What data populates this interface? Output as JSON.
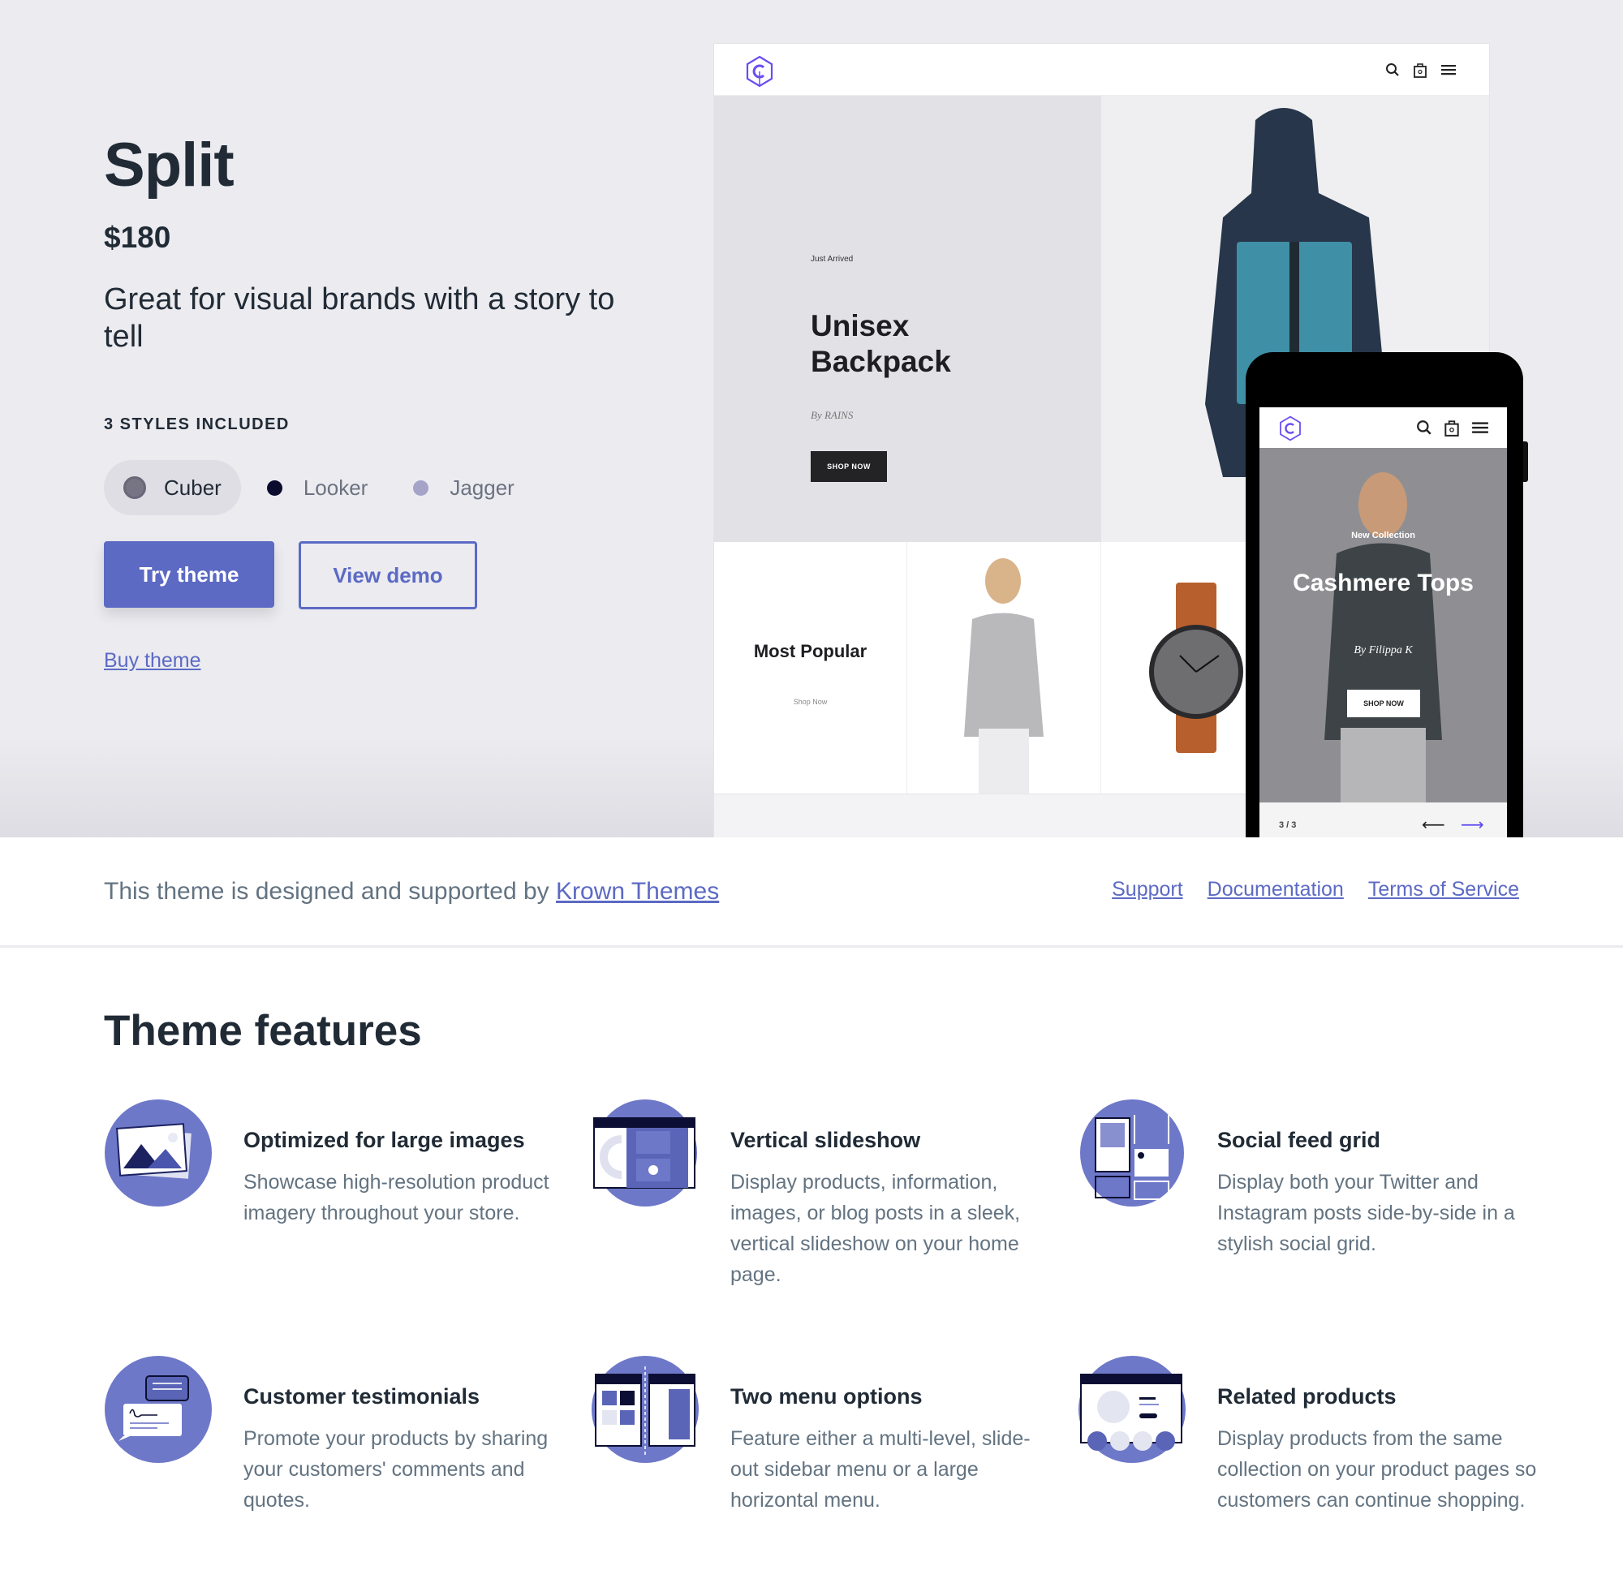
{
  "theme": {
    "name": "Split",
    "price": "$180",
    "tagline": "Great for visual brands with a story to tell",
    "styles_heading": "3 STYLES INCLUDED",
    "styles": [
      {
        "label": "Cuber",
        "color": "#777584",
        "selected": true
      },
      {
        "label": "Looker",
        "color": "#0b0b2e",
        "selected": false
      },
      {
        "label": "Jagger",
        "color": "#a6a3c8",
        "selected": false
      }
    ],
    "try_label": "Try theme",
    "demo_label": "View demo",
    "buy_label": "Buy theme",
    "accent": "#5c6ac4"
  },
  "desktop_preview": {
    "eyebrow": "Just Arrived",
    "title": "Unisex Backpack",
    "by": "By RAINS",
    "shop_label": "SHOP NOW",
    "tile_title": "Most Popular",
    "tile_link": "Shop Now",
    "icons": [
      "search-icon",
      "bag-icon",
      "menu-icon"
    ]
  },
  "mobile_preview": {
    "eyebrow": "New Collection",
    "title": "Cashmere Tops",
    "by": "By Filippa K",
    "shop_label": "SHOP NOW",
    "slide_count": "3 / 3",
    "prev_arrow": "⟵",
    "next_arrow": "⟶"
  },
  "credit": {
    "prefix": "This theme is designed and supported by ",
    "designer": "Krown Themes",
    "links": [
      "Support",
      "Documentation",
      "Terms of Service"
    ]
  },
  "features": {
    "title": "Theme features",
    "items": [
      {
        "title": "Optimized for large images",
        "desc": "Showcase high-resolution product imagery throughout your store.",
        "icon": "image-icon"
      },
      {
        "title": "Vertical slideshow",
        "desc": "Display products, information, images, or blog posts in a sleek, vertical slideshow on your home page.",
        "icon": "slideshow-icon"
      },
      {
        "title": "Social feed grid",
        "desc": "Display both your Twitter and Instagram posts side-by-side in a stylish social grid.",
        "icon": "social-grid-icon"
      },
      {
        "title": "Customer testimonials",
        "desc": "Promote your products by sharing your customers' comments and quotes.",
        "icon": "testimonial-icon"
      },
      {
        "title": "Two menu options",
        "desc": "Feature either a multi-level, slide-out sidebar menu or a large horizontal menu.",
        "icon": "menu-options-icon"
      },
      {
        "title": "Related products",
        "desc": "Display products from the same collection on your product pages so customers can continue shopping.",
        "icon": "related-products-icon"
      }
    ]
  }
}
